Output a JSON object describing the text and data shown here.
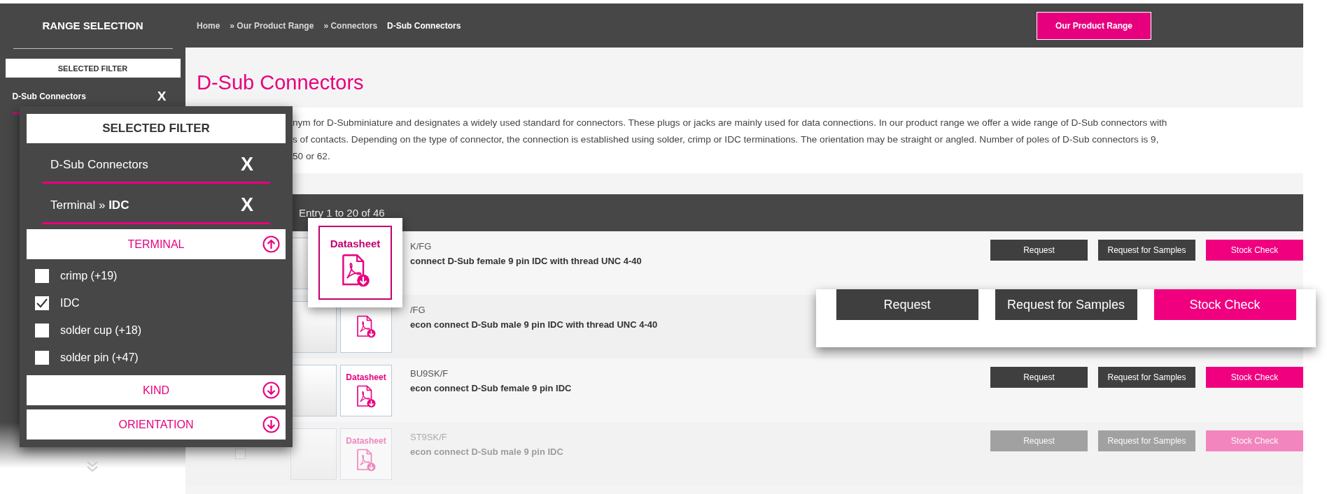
{
  "sidebar": {
    "title": "RANGE SELECTION",
    "heading": "SELECTED FILTER",
    "filters": [
      {
        "label": "D-Sub Connectors",
        "remove": "X"
      }
    ]
  },
  "breadcrumb": [
    {
      "label": "Home",
      "current": false
    },
    {
      "label": "» Our Product Range",
      "current": false
    },
    {
      "label": "» Connectors",
      "current": false
    },
    {
      "label": "D-Sub Connectors",
      "current": true
    }
  ],
  "header_button": "Our Product Range",
  "page_title": "D-Sub Connectors",
  "description_lines": [
    "nym for D-Subminiature and designates a widely used standard for connectors. These plugs or jacks are mainly used for data connections. In our product range we offer a wide range of D-Sub connectors with",
    "s of contacts. Depending on the type of connector, the connection is established using solder, crimp or IDC terminations. The orientation may be straight or angled. Number of poles of D-Sub connectors is 9,",
    "50 or 62."
  ],
  "table": {
    "entry_count": "Entry 1 to 20 of 46",
    "rows": [
      {
        "code": "K/FG",
        "name": "connect D-Sub female 9 pin IDC with thread UNC 4-40",
        "buttons": [
          {
            "label": "Request",
            "kind": "secondary"
          },
          {
            "label": "Request for Samples",
            "kind": "secondary"
          },
          {
            "label": "Stock Check",
            "kind": "primary"
          }
        ]
      },
      {
        "code": "/FG",
        "name": "econ connect D-Sub male 9 pin IDC with thread UNC 4-40"
      },
      {
        "code": "BU9SK/F",
        "name": "econ connect D-Sub female 9 pin IDC",
        "datasheet": "Datasheet",
        "buttons": [
          {
            "label": "Request",
            "kind": "secondary"
          },
          {
            "label": "Request for Samples",
            "kind": "secondary"
          },
          {
            "label": "Stock Check",
            "kind": "primary"
          }
        ]
      },
      {
        "code": "ST9SK/F",
        "name": "econ connect D-Sub male 9 pin IDC",
        "datasheet": "Datasheet",
        "checked": false,
        "buttons": [
          {
            "label": "Request",
            "kind": "secondary"
          },
          {
            "label": "Request for Samples",
            "kind": "secondary"
          },
          {
            "label": "Stock Check",
            "kind": "primary"
          }
        ]
      }
    ]
  },
  "filter_callout": {
    "heading": "SELECTED FILTER",
    "filters": [
      {
        "label": "D-Sub Connectors",
        "remove": "X"
      },
      {
        "label": "Terminal » **IDC**",
        "remove": "X"
      }
    ],
    "groups": [
      {
        "title": "TERMINAL",
        "expanded": true,
        "options": [
          {
            "label": "crimp (+19)",
            "checked": false
          },
          {
            "label": "IDC",
            "checked": true
          },
          {
            "label": "solder cup (+18)",
            "checked": false
          },
          {
            "label": "solder pin (+47)",
            "checked": false
          }
        ]
      },
      {
        "title": "KIND",
        "expanded": false
      },
      {
        "title": "ORIENTATION",
        "expanded": false
      }
    ]
  },
  "datasheet_callout": {
    "label": "Datasheet"
  },
  "buttons_callout": [
    {
      "label": "Request",
      "kind": "secondary"
    },
    {
      "label": "Request for Samples",
      "kind": "secondary"
    },
    {
      "label": "Stock Check",
      "kind": "primary"
    }
  ]
}
